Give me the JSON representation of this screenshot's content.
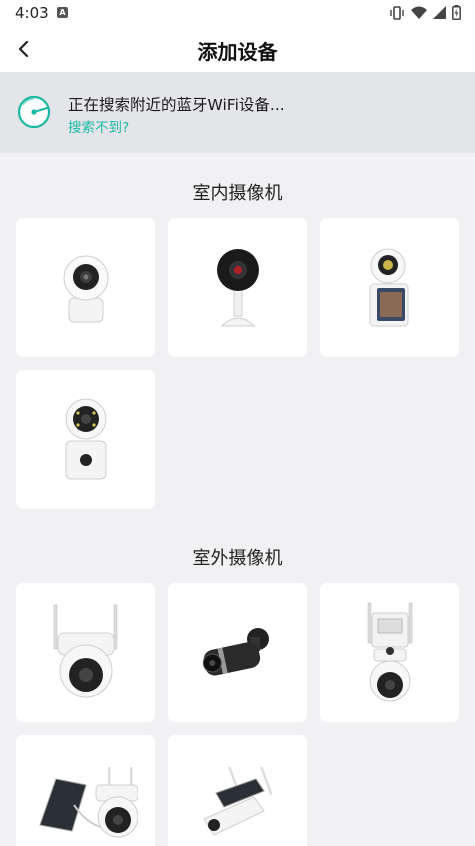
{
  "status_bar": {
    "time": "4:03",
    "notification_icon": "a-icon"
  },
  "header": {
    "title": "添加设备",
    "back_icon": "back-arrow-icon"
  },
  "scan": {
    "text": "正在搜索附近的蓝牙WiFi设备...",
    "link": "搜索不到?"
  },
  "sections": [
    {
      "title": "室内摄像机",
      "devices": [
        "ptz-dome-camera",
        "cube-camera",
        "dual-lens-video-call-camera",
        "dual-lens-dome-camera"
      ]
    },
    {
      "title": "室外摄像机",
      "devices": [
        "outdoor-ptz-camera",
        "bullet-camera",
        "dual-lens-outdoor-ptz-camera",
        "solar-ptz-camera",
        "solar-bullet-camera"
      ]
    }
  ],
  "colors": {
    "accent": "#1ab9a4",
    "banner": "#e4e5e8",
    "background": "#f1f1f3"
  }
}
